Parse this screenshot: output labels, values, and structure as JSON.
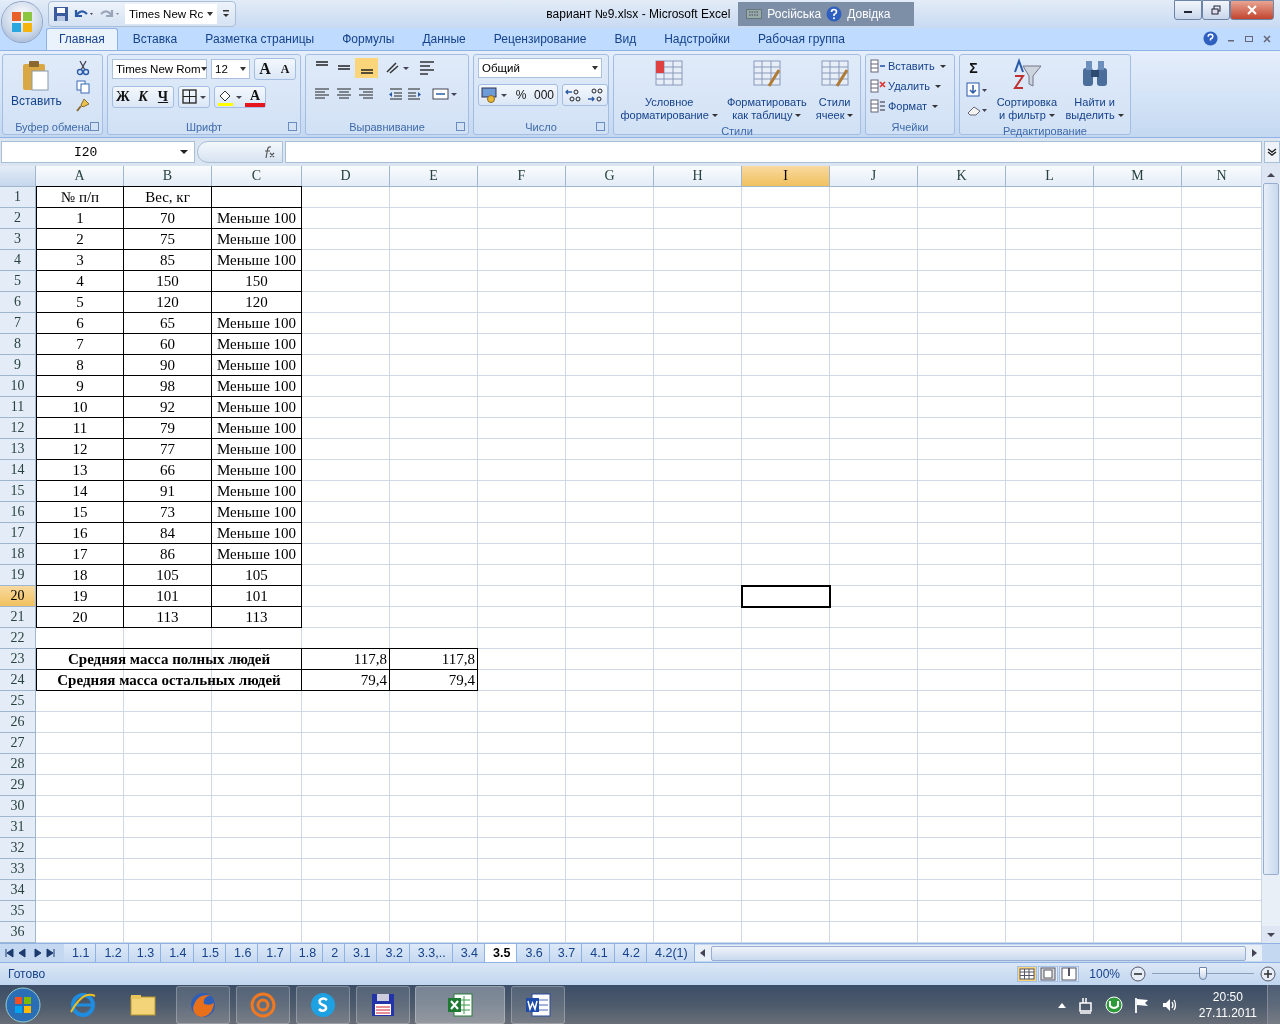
{
  "title_bar": {
    "font_box": "Times New Rc",
    "title": "вариант №9.xlsx - Microsoft Excel",
    "language": "Російська",
    "help": "Довідка"
  },
  "ribbon_tabs": [
    {
      "label": "Главная",
      "selected": true
    },
    {
      "label": "Вставка",
      "selected": false
    },
    {
      "label": "Разметка страницы",
      "selected": false
    },
    {
      "label": "Формулы",
      "selected": false
    },
    {
      "label": "Данные",
      "selected": false
    },
    {
      "label": "Рецензирование",
      "selected": false
    },
    {
      "label": "Вид",
      "selected": false
    },
    {
      "label": "Надстройки",
      "selected": false
    },
    {
      "label": "Рабочая группа",
      "selected": false
    }
  ],
  "ribbon": {
    "clipboard": {
      "paste": "Вставить",
      "label": "Буфер обмена"
    },
    "font": {
      "name": "Times New Rom",
      "size": "12",
      "grow": "A",
      "shrink": "A",
      "bold": "Ж",
      "italic": "К",
      "underline": "Ч",
      "color_button": "A",
      "label": "Шрифт"
    },
    "alignment": {
      "label": "Выравнивание"
    },
    "number": {
      "format": "Общий",
      "percent": "%",
      "thousands": "000",
      "label": "Число"
    },
    "styles": {
      "buttons": [
        [
          "Условное",
          "форматирование"
        ],
        [
          "Форматировать",
          "как таблицу"
        ],
        [
          "Стили",
          "ячеек"
        ]
      ],
      "label": "Стили"
    },
    "cells": {
      "buttons": [
        "Вставить",
        "Удалить",
        "Формат"
      ],
      "label": "Ячейки"
    },
    "editing": {
      "sum": "Σ",
      "buttons": [
        [
          "Сортировка",
          "и фильтр"
        ],
        [
          "Найти и",
          "выделить"
        ]
      ],
      "label": "Редактирование"
    }
  },
  "formula_bar": {
    "name_box": "I20"
  },
  "sheet": {
    "columns": [
      {
        "label": "A",
        "selected": false
      },
      {
        "label": "B",
        "selected": false
      },
      {
        "label": "C",
        "selected": false
      },
      {
        "label": "D",
        "selected": false
      },
      {
        "label": "E",
        "selected": false
      },
      {
        "label": "F",
        "selected": false
      },
      {
        "label": "G",
        "selected": false
      },
      {
        "label": "H",
        "selected": false
      },
      {
        "label": "I",
        "selected": true
      },
      {
        "label": "J",
        "selected": false
      },
      {
        "label": "K",
        "selected": false
      },
      {
        "label": "L",
        "selected": false
      },
      {
        "label": "M",
        "selected": false
      },
      {
        "label": "N",
        "selected": false
      }
    ],
    "rows": [
      {
        "number": "1",
        "selected": false,
        "kind": "data",
        "cells": [
          "№ п/п",
          "Вес, кг",
          null
        ]
      },
      {
        "number": "2",
        "selected": false,
        "kind": "data",
        "cells": [
          "1",
          "70",
          "Меньше 100"
        ]
      },
      {
        "number": "3",
        "selected": false,
        "kind": "data",
        "cells": [
          "2",
          "75",
          "Меньше 100"
        ]
      },
      {
        "number": "4",
        "selected": false,
        "kind": "data",
        "cells": [
          "3",
          "85",
          "Меньше 100"
        ]
      },
      {
        "number": "5",
        "selected": false,
        "kind": "data",
        "cells": [
          "4",
          "150",
          "150"
        ]
      },
      {
        "number": "6",
        "selected": false,
        "kind": "data",
        "cells": [
          "5",
          "120",
          "120"
        ]
      },
      {
        "number": "7",
        "selected": false,
        "kind": "data",
        "cells": [
          "6",
          "65",
          "Меньше 100"
        ]
      },
      {
        "number": "8",
        "selected": false,
        "kind": "data",
        "cells": [
          "7",
          "60",
          "Меньше 100"
        ]
      },
      {
        "number": "9",
        "selected": false,
        "kind": "data",
        "cells": [
          "8",
          "90",
          "Меньше 100"
        ]
      },
      {
        "number": "10",
        "selected": false,
        "kind": "data",
        "cells": [
          "9",
          "98",
          "Меньше 100"
        ]
      },
      {
        "number": "11",
        "selected": false,
        "kind": "data",
        "cells": [
          "10",
          "92",
          "Меньше 100"
        ]
      },
      {
        "number": "12",
        "selected": false,
        "kind": "data",
        "cells": [
          "11",
          "79",
          "Меньше 100"
        ]
      },
      {
        "number": "13",
        "selected": false,
        "kind": "data",
        "cells": [
          "12",
          "77",
          "Меньше 100"
        ]
      },
      {
        "number": "14",
        "selected": false,
        "kind": "data",
        "cells": [
          "13",
          "66",
          "Меньше 100"
        ]
      },
      {
        "number": "15",
        "selected": false,
        "kind": "data",
        "cells": [
          "14",
          "91",
          "Меньше 100"
        ]
      },
      {
        "number": "16",
        "selected": false,
        "kind": "data",
        "cells": [
          "15",
          "73",
          "Меньше 100"
        ]
      },
      {
        "number": "17",
        "selected": false,
        "kind": "data",
        "cells": [
          "16",
          "84",
          "Меньше 100"
        ]
      },
      {
        "number": "18",
        "selected": false,
        "kind": "data",
        "cells": [
          "17",
          "86",
          "Меньше 100"
        ]
      },
      {
        "number": "19",
        "selected": false,
        "kind": "data",
        "cells": [
          "18",
          "105",
          "105"
        ]
      },
      {
        "number": "20",
        "selected": true,
        "kind": "data",
        "cells": [
          "19",
          "101",
          "101"
        ]
      },
      {
        "number": "21",
        "selected": false,
        "kind": "data",
        "cells": [
          "20",
          "113",
          "113"
        ]
      },
      {
        "number": "22",
        "selected": false,
        "kind": "empty"
      },
      {
        "number": "23",
        "selected": false,
        "kind": "summary",
        "label": "Средняя масса полных людей",
        "values": [
          "117,8",
          "117,8"
        ]
      },
      {
        "number": "24",
        "selected": false,
        "kind": "summary",
        "label": "Средняя масса остальных людей",
        "values": [
          "79,4",
          "79,4"
        ]
      },
      {
        "number": "25",
        "selected": false,
        "kind": "empty"
      },
      {
        "number": "26",
        "selected": false,
        "kind": "empty"
      },
      {
        "number": "27",
        "selected": false,
        "kind": "empty"
      },
      {
        "number": "28",
        "selected": false,
        "kind": "empty"
      },
      {
        "number": "29",
        "selected": false,
        "kind": "empty"
      },
      {
        "number": "30",
        "selected": false,
        "kind": "empty"
      },
      {
        "number": "31",
        "selected": false,
        "kind": "empty"
      },
      {
        "number": "32",
        "selected": false,
        "kind": "empty"
      },
      {
        "number": "33",
        "selected": false,
        "kind": "empty"
      },
      {
        "number": "34",
        "selected": false,
        "kind": "empty"
      },
      {
        "number": "35",
        "selected": false,
        "kind": "empty"
      },
      {
        "number": "36",
        "selected": false,
        "kind": "empty"
      }
    ]
  },
  "sheet_tabs": [
    {
      "label": "1.1",
      "selected": false
    },
    {
      "label": "1.2",
      "selected": false
    },
    {
      "label": "1.3",
      "selected": false
    },
    {
      "label": "1.4",
      "selected": false
    },
    {
      "label": "1.5",
      "selected": false
    },
    {
      "label": "1.6",
      "selected": false
    },
    {
      "label": "1.7",
      "selected": false
    },
    {
      "label": "1.8",
      "selected": false
    },
    {
      "label": "2",
      "selected": false
    },
    {
      "label": "3.1",
      "selected": false
    },
    {
      "label": "3.2",
      "selected": false
    },
    {
      "label": "3.3,..",
      "selected": false
    },
    {
      "label": "3.4",
      "selected": false
    },
    {
      "label": "3.5",
      "selected": true
    },
    {
      "label": "3.6",
      "selected": false
    },
    {
      "label": "3.7",
      "selected": false
    },
    {
      "label": "4.1",
      "selected": false
    },
    {
      "label": "4.2",
      "selected": false
    },
    {
      "label": "4.2(1)",
      "selected": false
    }
  ],
  "status_bar": {
    "status": "Готово",
    "zoom": "100%",
    "zoom_slider": {
      "level": 0.5
    }
  },
  "taskbar": {
    "time": "20:50",
    "date": "27.11.2011"
  }
}
